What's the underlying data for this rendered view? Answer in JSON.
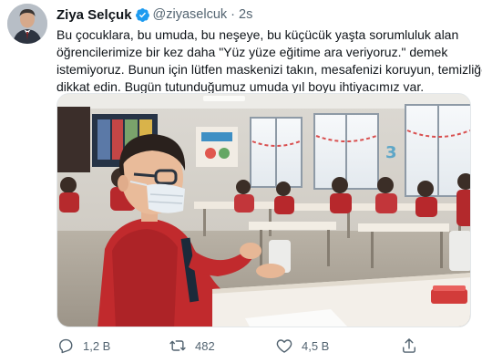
{
  "tweet": {
    "author": {
      "name": "Ziya Selçuk",
      "handle": "@ziyaselcuk",
      "verified": true
    },
    "separator": "·",
    "time": "2s",
    "text_lines": [
      "Bu çocuklara, bu umuda, bu neşeye, bu küçücük yaşta sorumluluk alan",
      "öğrencilerimize bir kez daha \"Yüz yüze eğitime ara veriyoruz.\" demek",
      "istemiyoruz. Bunun için lütfen maskenizi takın, mesafenizi koruyun, temizliğe",
      "dikkat edin. Bugün tutunduğumuz umuda yıl boyu ihtiyacımız var."
    ],
    "actions": {
      "reply": {
        "icon": "reply-icon",
        "count": "1,2 B"
      },
      "retweet": {
        "icon": "retweet-icon",
        "count": "482"
      },
      "like": {
        "icon": "heart-icon",
        "count": "4,5 B"
      },
      "share": {
        "icon": "share-icon"
      }
    }
  },
  "colors": {
    "text": "#0f1419",
    "secondary": "#536471",
    "verified": "#1d9bf0",
    "border": "#e3e7ea"
  }
}
